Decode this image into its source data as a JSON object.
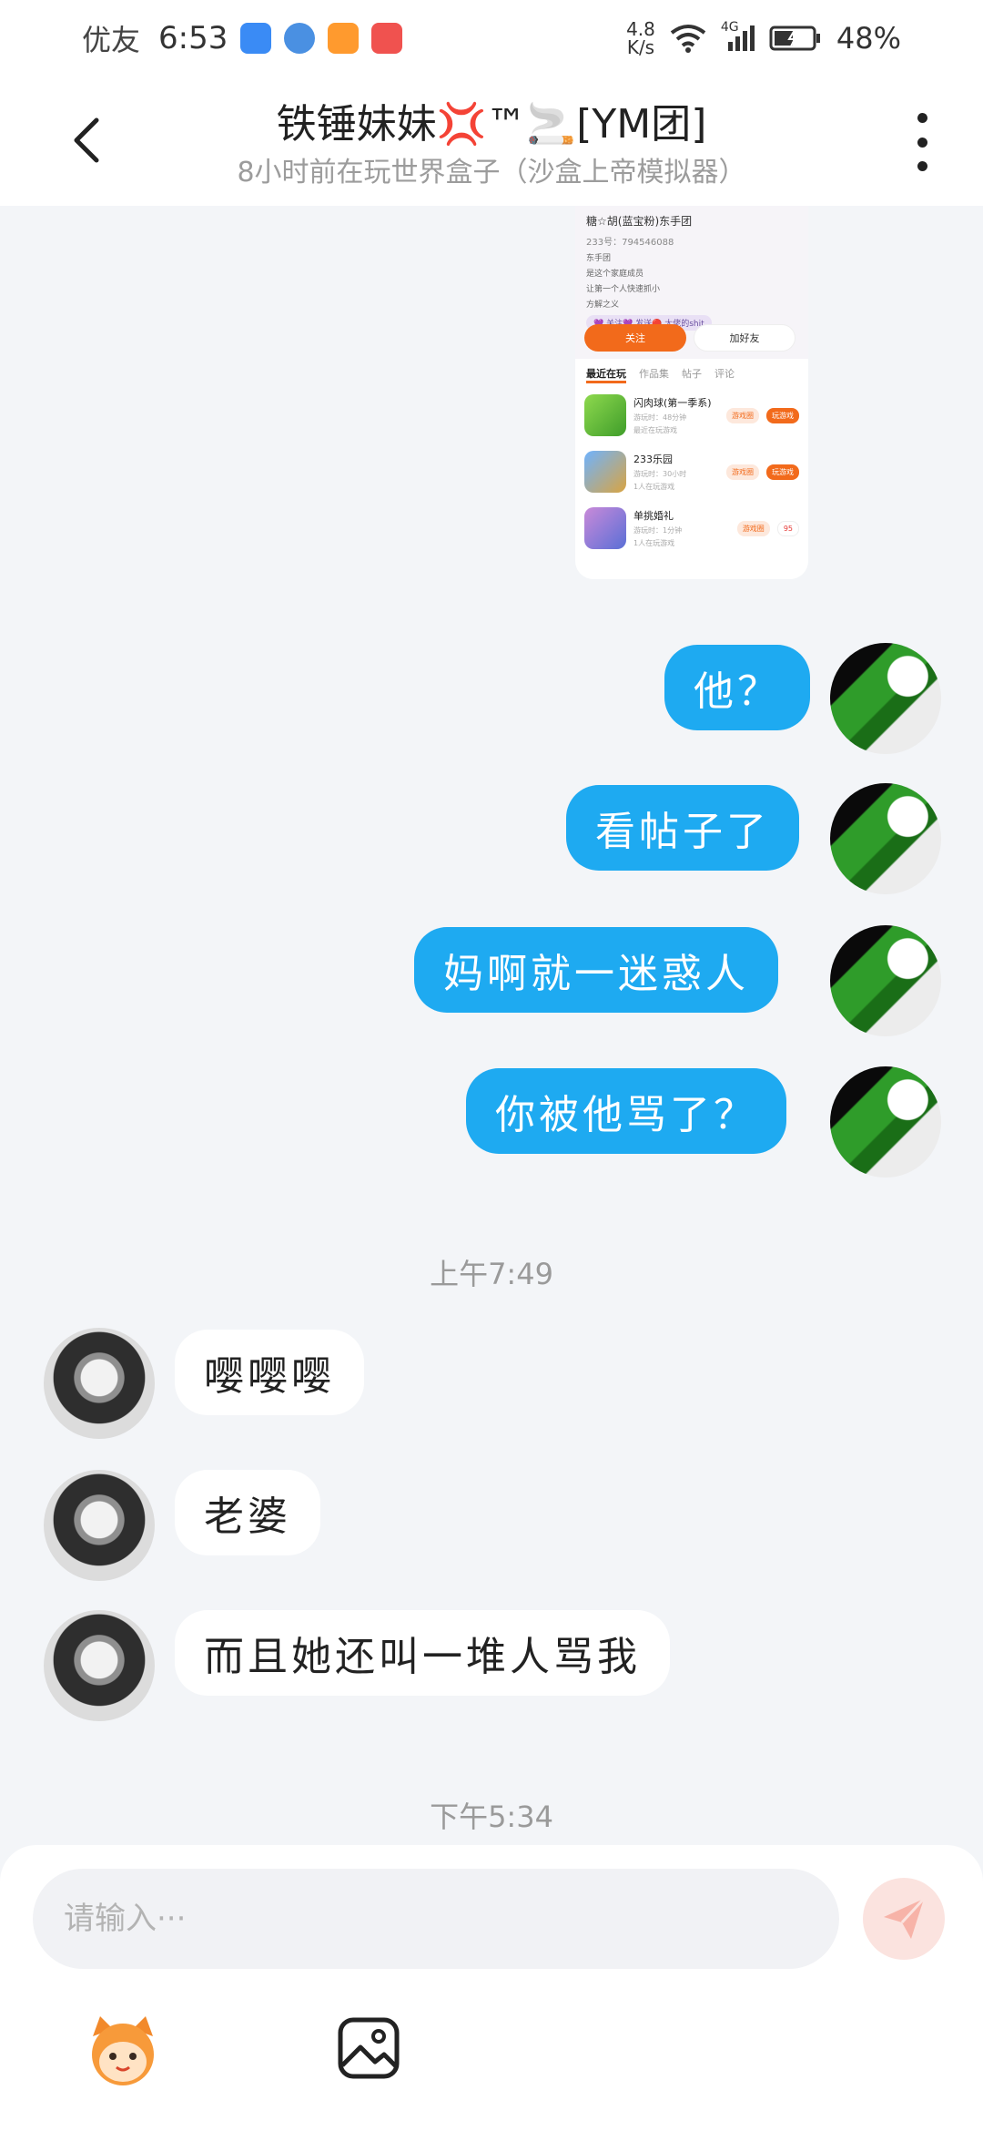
{
  "status_bar": {
    "carrier": "优友",
    "time": "6:53",
    "speed_value": "4.8",
    "speed_unit": "K/s",
    "network": "4G",
    "battery": "48%"
  },
  "header": {
    "title": "铁锤妹妹💢™🚬[YM团]",
    "subtitle": "8小时前在玩世界盒子（沙盒上帝模拟器）"
  },
  "shared_screenshot": {
    "profile_name": "糖☆胡(蓝宝粉)东手团",
    "profile_id": "233号：794546088",
    "bio_lines": [
      "东手团",
      "是这个家庭成员",
      "让第一个人快速抓小",
      "方解之义"
    ],
    "badge": "💜 关注💜 发送🔴 大佬的shit",
    "follow_label": "关注",
    "add_friend_label": "加好友",
    "tabs": [
      "最近在玩",
      "作品集",
      "帖子",
      "评论"
    ],
    "games": [
      {
        "name": "闪肉球(第一季系)",
        "meta": "游玩时：48分钟",
        "meta2": "最近在玩游戏",
        "chip1": "游戏圈",
        "chip2": "玩游戏"
      },
      {
        "name": "233乐园",
        "meta": "游玩时：30小时",
        "meta2": "1人在玩游戏",
        "chip1": "游戏圈",
        "chip2": "玩游戏"
      },
      {
        "name": "单挑婚礼",
        "meta": "游玩时：1分钟",
        "meta2": "1人在玩游戏",
        "chip1": "游戏圈",
        "chip2": "95"
      }
    ]
  },
  "messages": {
    "out": [
      "他？",
      "看帖子了",
      "妈啊就一迷惑人",
      "你被他骂了？"
    ],
    "in": [
      "嘤嘤嘤",
      "老婆",
      "而且她还叫一堆人骂我"
    ]
  },
  "timestamps": [
    "上午7:49",
    "下午5:34"
  ],
  "input": {
    "placeholder": "请输入···",
    "value": ""
  },
  "colors": {
    "bubble_out": "#1eaaf1",
    "accent_orange": "#f26a1b",
    "send_disabled": "#fbe3df"
  },
  "icons": {
    "back": "chevron-left-icon",
    "more": "more-vertical-icon",
    "send": "paper-plane-icon",
    "emoji": "cartoon-emoji-icon",
    "image": "image-icon"
  }
}
